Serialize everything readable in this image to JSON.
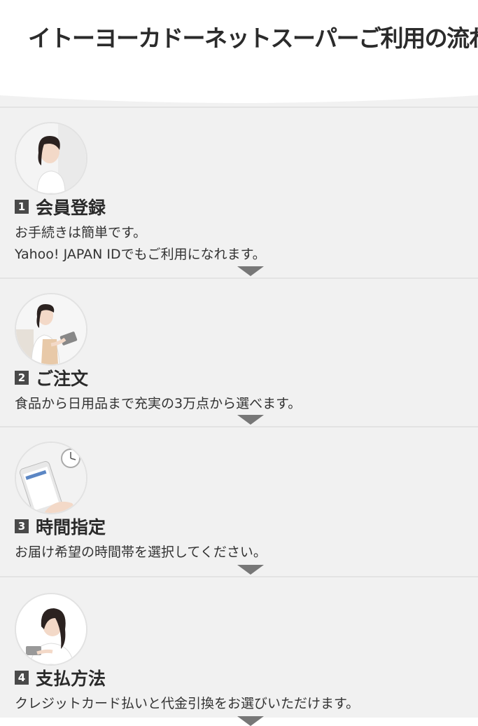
{
  "header": {
    "title": "イトーヨーカドーネットスーパーご利用の流れ"
  },
  "steps": [
    {
      "number": "1",
      "title": "会員登録",
      "desc_line1": "お手続きは簡単です。",
      "desc_line2": "Yahoo! JAPAN IDでもご利用になれます。",
      "image": "woman-smiling-photo"
    },
    {
      "number": "2",
      "title": "ご注文",
      "desc_line1": "食品から日用品まで充実の3万点から選べます。",
      "image": "woman-with-tablet-photo"
    },
    {
      "number": "3",
      "title": "時間指定",
      "desc_line1": "お届け希望の時間帯を選択してください。",
      "image": "smartphone-and-clock-photo"
    },
    {
      "number": "4",
      "title": "支払方法",
      "desc_line1": "クレジットカード払いと代金引換をお選びいただけます。",
      "image": "woman-with-card-photo"
    }
  ],
  "colors": {
    "panel_bg": "#f1f1f1",
    "badge_bg": "#4a4a4a",
    "arrow": "#777777"
  }
}
